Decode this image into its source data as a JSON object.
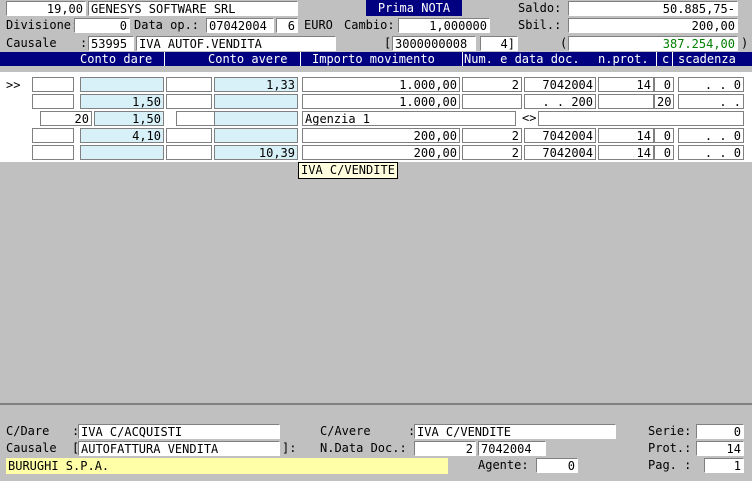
{
  "header": {
    "company_code": "19,00",
    "company_name": "GENESYS SOFTWARE SRL",
    "title": "Prima NOTA",
    "saldo_label": "Saldo:",
    "saldo_value": "50.885,75-",
    "divisione_label": "Divisione:",
    "divisione_value": "0",
    "data_op_label": "Data op.:",
    "data_op_value": "07042004",
    "data_op_num": "6",
    "euro_label": "EURO",
    "cambio_label": "Cambio:",
    "cambio_value": "1,000000",
    "sbil_label": "Sbil.:",
    "sbil_value": "200,00",
    "causale_label": "Causale",
    "causale_colon": ":",
    "causale_code": "53995",
    "causale_desc": "IVA AUTOF.VENDITA",
    "bracket_open": "[",
    "ref_code": "3000000008",
    "ref_num": "4]",
    "paren_open": "(",
    "amount_green": "387.254,00",
    "paren_close": ")"
  },
  "columns": [
    "Conto dare",
    "Conto avere",
    "Importo movimento",
    "Num. e data doc.",
    "n.prot.",
    "c",
    "scadenza"
  ],
  "grid": {
    "row_marker": ">>",
    "rows": [
      {
        "dare_a": "",
        "dare_b": "",
        "avere_a": "",
        "avere_b": "1,33",
        "importo": "1.000,00",
        "num": "2",
        "data": "7042004",
        "prot": "14",
        "c": "0",
        "scad": ". .      0"
      },
      {
        "dare_a": "",
        "dare_b": "1,50",
        "avere_a": "",
        "avere_b": "",
        "importo": "1.000,00",
        "num": "",
        "data": ". .  200",
        "prot": "",
        "c": "20",
        "scad": ". ."
      },
      {
        "dare_a": "20",
        "dare_b": "1,50",
        "avere_a": "",
        "avere_b": "",
        "importo": "Agenzia 1",
        "num": "",
        "data": "<>",
        "prot": "",
        "c": "",
        "scad": ""
      },
      {
        "dare_a": "",
        "dare_b": "4,10",
        "avere_a": "",
        "avere_b": "",
        "importo": "200,00",
        "num": "2",
        "data": "7042004",
        "prot": "14",
        "c": "0",
        "scad": ". .      0"
      },
      {
        "dare_a": "",
        "dare_b": "",
        "avere_a": "",
        "avere_b": "10,39",
        "importo": "200,00",
        "num": "2",
        "data": "7042004",
        "prot": "14",
        "c": "0",
        "scad": ". .      0"
      }
    ]
  },
  "tooltip": "IVA C/VENDITE",
  "footer": {
    "cdare_label": "C/Dare",
    "cdare_colon": ":",
    "cdare_value": "IVA C/ACQUISTI",
    "cavere_label": "C/Avere",
    "cavere_colon": ":",
    "cavere_value": "IVA C/VENDITE",
    "serie_label": "Serie:",
    "serie_value": "0",
    "causale_label": "Causale",
    "causale_open": "[",
    "causale_value": "AUTOFATTURA VENDITA",
    "causale_close": "]:",
    "ndata_label": "N.Data Doc.:",
    "ndata_num": "2",
    "ndata_date": "7042004",
    "prot_label": "Prot.:",
    "prot_value": "14",
    "client_name": "BURUGHI S.P.A.",
    "agente_label": "Agente:",
    "agente_value": "0",
    "pag_label": "Pag. :",
    "pag_value": "1"
  },
  "colors": {
    "titlebar": "#000080",
    "green_amount": "#008000",
    "grid_cyan": "#d8f0f8",
    "client_bar": "#ffffa8"
  }
}
